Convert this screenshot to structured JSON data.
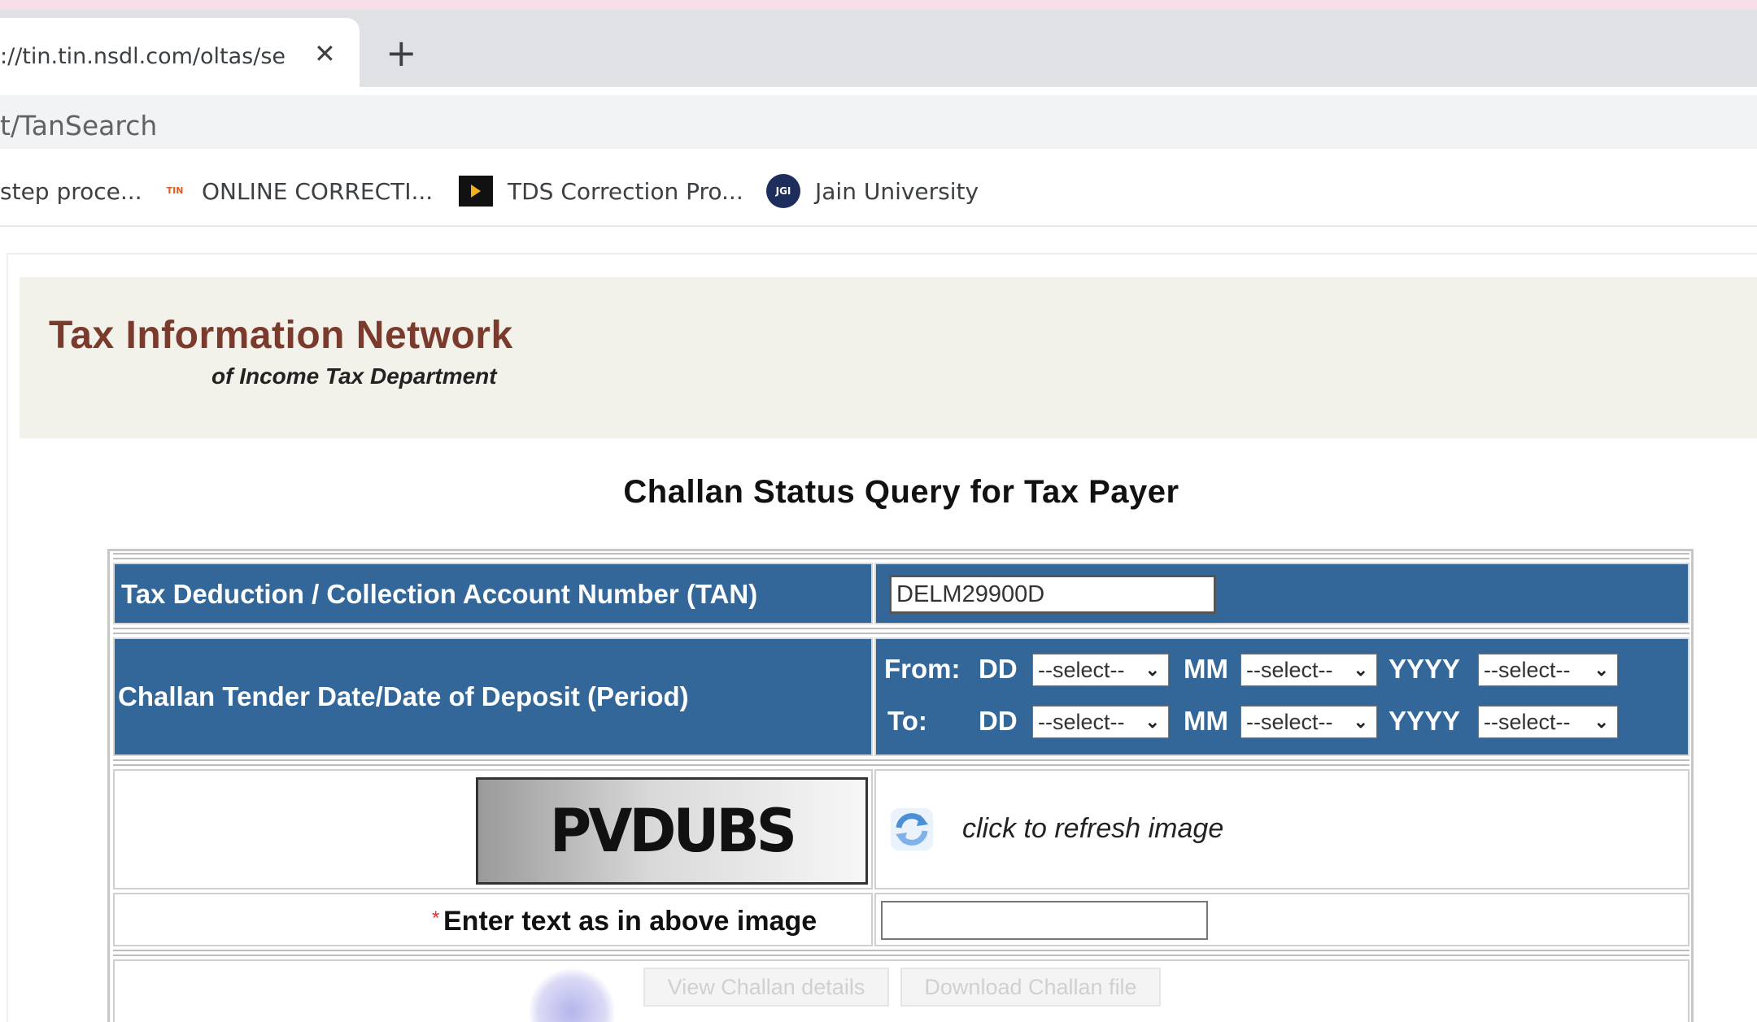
{
  "browser": {
    "tab": {
      "title": "://tin.tin.nsdl.com/oltas/serv",
      "close_icon": "close-icon"
    },
    "new_tab_icon": "plus-icon",
    "address": {
      "url": "t/TanSearch"
    },
    "bookmarks": [
      {
        "label": "step proce...",
        "icon": "none"
      },
      {
        "label": "ONLINE CORRECTI...",
        "icon": "tin-icon",
        "icon_text": "TIN"
      },
      {
        "label": "TDS Correction Pro...",
        "icon": "play-icon"
      },
      {
        "label": "Jain University",
        "icon": "jgi-logo-icon",
        "icon_text": "JGI"
      }
    ]
  },
  "header": {
    "title": "Tax Information Network",
    "subtitle": "of Income Tax Department"
  },
  "page_heading": "Challan Status Query for Tax Payer",
  "form": {
    "tan": {
      "label": "Tax Deduction / Collection Account Number (TAN)",
      "value": "DELM29900D"
    },
    "period": {
      "label": "Challan Tender Date/Date of Deposit (Period)",
      "from_label": "From:",
      "to_label": "To:",
      "dd_label": "DD",
      "mm_label": "MM",
      "yyyy_label": "YYYY",
      "select_placeholder": "--select--"
    },
    "captcha": {
      "image_text": "PVDUBS",
      "refresh_text": "click to refresh image",
      "required_mark": "*",
      "input_label": "Enter text as in above image",
      "input_value": ""
    },
    "buttons": {
      "view": "View Challan details",
      "download": "Download Challan file"
    }
  },
  "colors": {
    "row_blue": "#336699",
    "brand_red": "#7a3a2c",
    "banner_bg": "#f2f1ea"
  }
}
